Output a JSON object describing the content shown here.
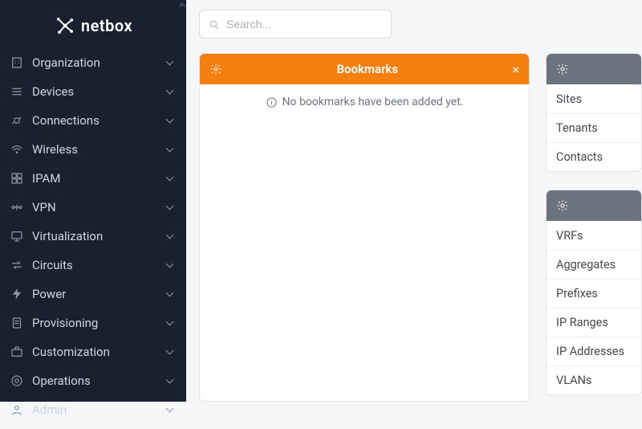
{
  "brand": {
    "name": "netbox"
  },
  "sidebar": {
    "items": [
      {
        "label": "Organization",
        "icon": "building-icon"
      },
      {
        "label": "Devices",
        "icon": "list-icon"
      },
      {
        "label": "Connections",
        "icon": "plug-icon"
      },
      {
        "label": "Wireless",
        "icon": "wifi-icon"
      },
      {
        "label": "IPAM",
        "icon": "grid-icon"
      },
      {
        "label": "VPN",
        "icon": "vpn-icon"
      },
      {
        "label": "Virtualization",
        "icon": "monitor-icon"
      },
      {
        "label": "Circuits",
        "icon": "swap-icon"
      },
      {
        "label": "Power",
        "icon": "bolt-icon"
      },
      {
        "label": "Provisioning",
        "icon": "doc-icon"
      },
      {
        "label": "Customization",
        "icon": "briefcase-icon"
      },
      {
        "label": "Operations",
        "icon": "ops-icon"
      },
      {
        "label": "Admin",
        "icon": "admin-icon"
      }
    ]
  },
  "search": {
    "placeholder": "Search..."
  },
  "bookmarks": {
    "title": "Bookmarks",
    "empty": "No bookmarks have been added yet."
  },
  "right_panels": [
    {
      "items": [
        "Sites",
        "Tenants",
        "Contacts"
      ]
    },
    {
      "items": [
        "VRFs",
        "Aggregates",
        "Prefixes",
        "IP Ranges",
        "IP Addresses",
        "VLANs"
      ]
    }
  ],
  "colors": {
    "accent": "#f77f0e",
    "sidebar_bg": "#1b2030",
    "panel_head_gray": "#6c7380"
  }
}
